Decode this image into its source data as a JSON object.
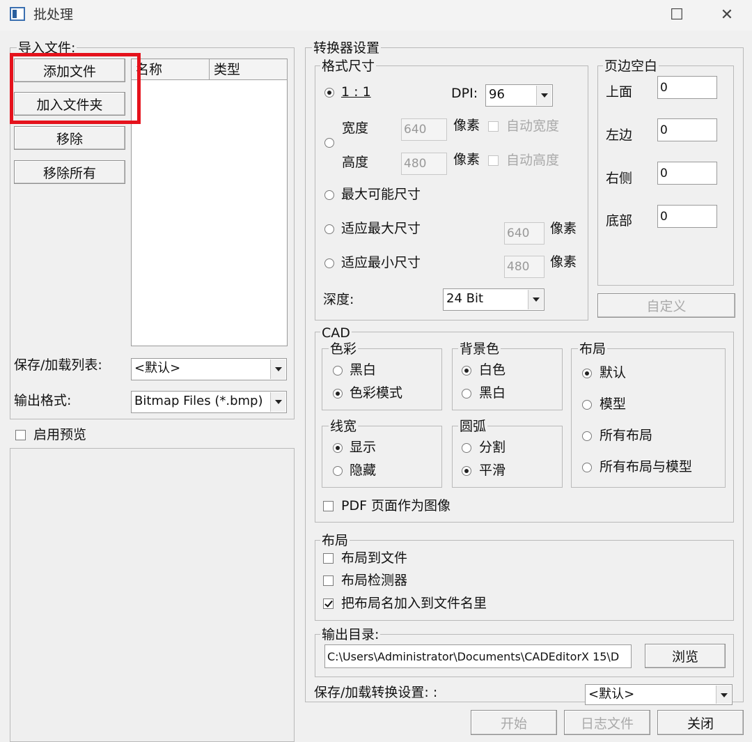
{
  "window": {
    "title": "批处理",
    "maximize_glyph": "☐",
    "close_glyph": "✕"
  },
  "import_files": {
    "group_title": "导入文件:",
    "buttons": {
      "add_file": "添加文件",
      "add_folder": "加入文件夹",
      "remove": "移除",
      "remove_all": "移除所有"
    },
    "list_columns": [
      "名称",
      "类型"
    ],
    "save_load_list_label": "保存/加载列表:",
    "save_load_list_value": "<默认>",
    "output_format_label": "输出格式:",
    "output_format_value": "Bitmap Files (*.bmp)"
  },
  "preview": {
    "label": "启用预览",
    "checked": false
  },
  "converter": {
    "group_title": "转换器设置",
    "format_size": {
      "group_title": "格式尺寸",
      "one_to_one": "1 : 1",
      "dpi_label": "DPI:",
      "dpi_value": "96",
      "width_label": "宽度",
      "width_value": "640",
      "height_label": "高度",
      "height_value": "480",
      "pixel_unit": "像素",
      "auto_width": "自动宽度",
      "auto_height": "自动高度",
      "max_possible": "最大可能尺寸",
      "fit_max": "适应最大尺寸",
      "fit_max_value": "640",
      "fit_min": "适应最小尺寸",
      "fit_min_value": "480",
      "depth_label": "深度:",
      "depth_value": "24 Bit"
    },
    "margins": {
      "group_title": "页边空白",
      "top_label": "上面",
      "top_value": "0",
      "left_label": "左边",
      "left_value": "0",
      "right_label": "右侧",
      "right_value": "0",
      "bottom_label": "底部",
      "bottom_value": "0",
      "custom_button": "自定义"
    },
    "cad": {
      "group_title": "CAD",
      "color": {
        "title": "色彩",
        "opt_bw": "黑白",
        "opt_color": "色彩模式"
      },
      "background": {
        "title": "背景色",
        "opt_white": "白色",
        "opt_black": "黑白"
      },
      "layout": {
        "title": "布局",
        "opt_default": "默认",
        "opt_model": "模型",
        "opt_all": "所有布局",
        "opt_all_model": "所有布局与模型"
      },
      "linewidth": {
        "title": "线宽",
        "opt_show": "显示",
        "opt_hide": "隐藏"
      },
      "arc": {
        "title": "圆弧",
        "opt_split": "分割",
        "opt_smooth": "平滑"
      },
      "pdf_as_image": "PDF 页面作为图像"
    },
    "layout_group": {
      "group_title": "布局",
      "layout_to_file": "布局到文件",
      "layout_detector": "布局检测器",
      "add_layout_name": "把布局名加入到文件名里"
    },
    "output_dir": {
      "group_title": "输出目录:",
      "path": "C:\\Users\\Administrator\\Documents\\CADEditorX 15\\D",
      "browse_button": "浏览"
    },
    "save_load_settings_label": "保存/加载转换设置: :",
    "save_load_settings_value": "<默认>"
  },
  "footer": {
    "start": "开始",
    "log_file": "日志文件",
    "close": "关闭"
  }
}
